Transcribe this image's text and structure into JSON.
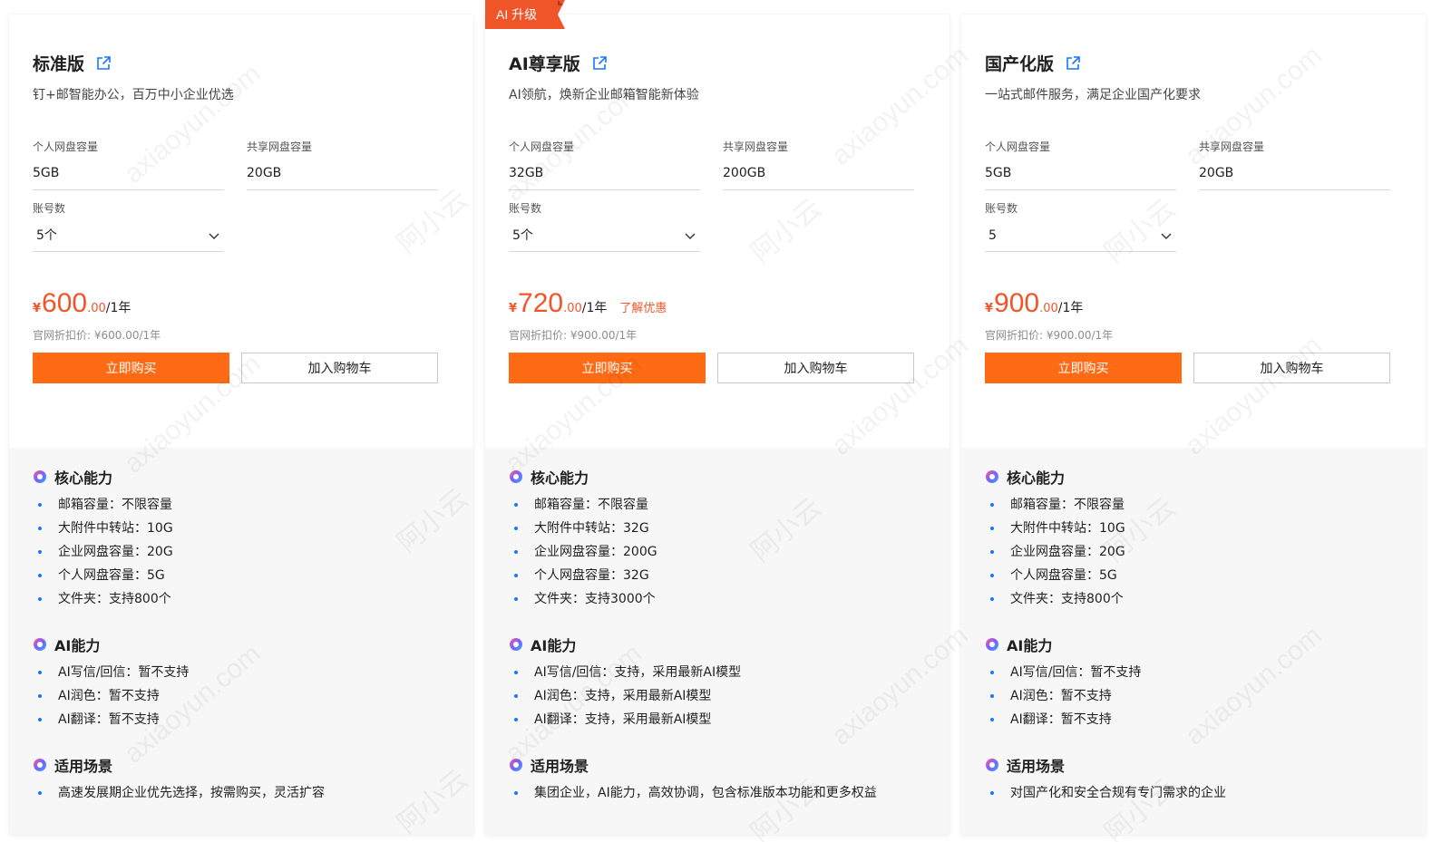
{
  "labels": {
    "personal_disk": "个人网盘容量",
    "shared_disk": "共享网盘容量",
    "accounts": "账号数",
    "buy": "立即购买",
    "add_cart": "加入购物车",
    "currency": "¥"
  },
  "watermark": {
    "site": "axiaoyun.com",
    "brand": "阿小云"
  },
  "colors": {
    "accent": "#ff6a14",
    "badge": "#f0552a",
    "bullet": "#1677ff",
    "bottom_bg": "#f7f7f7"
  },
  "plans": [
    {
      "badge": "",
      "title": "标准版",
      "subtitle": "钉+邮智能办公，百万中小企业优选",
      "personal_disk": "5GB",
      "shared_disk": "20GB",
      "accounts": "5个",
      "price_int": "600",
      "price_dec": ".00",
      "price_unit": "/1年",
      "promo": "",
      "orig_price": "官网折扣价: ¥600.00/1年",
      "sections": [
        {
          "title": "核心能力",
          "items": [
            "邮箱容量：不限容量",
            "大附件中转站：10G",
            "企业网盘容量：20G",
            "个人网盘容量：5G",
            "文件夹：支持800个"
          ]
        },
        {
          "title": "AI能力",
          "items": [
            "AI写信/回信：暂不支持",
            "AI润色：暂不支持",
            "AI翻译：暂不支持"
          ]
        },
        {
          "title": "适用场景",
          "items": [
            "高速发展期企业优先选择，按需购买，灵活扩容"
          ]
        }
      ]
    },
    {
      "badge": "AI 升级",
      "title": "AI尊享版",
      "subtitle": "AI领航，焕新企业邮箱智能新体验",
      "personal_disk": "32GB",
      "shared_disk": "200GB",
      "accounts": "5个",
      "price_int": "720",
      "price_dec": ".00",
      "price_unit": "/1年",
      "promo": "了解优惠",
      "orig_price": "官网折扣价: ¥900.00/1年",
      "sections": [
        {
          "title": "核心能力",
          "items": [
            "邮箱容量：不限容量",
            "大附件中转站：32G",
            "企业网盘容量：200G",
            "个人网盘容量：32G",
            "文件夹：支持3000个"
          ]
        },
        {
          "title": "AI能力",
          "items": [
            "AI写信/回信：支持，采用最新AI模型",
            "AI润色：支持，采用最新AI模型",
            "AI翻译：支持，采用最新AI模型"
          ]
        },
        {
          "title": "适用场景",
          "items": [
            "集团企业，AI能力，高效协调，包含标准版本功能和更多权益"
          ]
        }
      ]
    },
    {
      "badge": "",
      "title": "国产化版",
      "subtitle": "一站式邮件服务，满足企业国产化要求",
      "personal_disk": "5GB",
      "shared_disk": "20GB",
      "accounts": "5",
      "price_int": "900",
      "price_dec": ".00",
      "price_unit": "/1年",
      "promo": "",
      "orig_price": "官网折扣价: ¥900.00/1年",
      "sections": [
        {
          "title": "核心能力",
          "items": [
            "邮箱容量：不限容量",
            "大附件中转站：10G",
            "企业网盘容量：20G",
            "个人网盘容量：5G",
            "文件夹：支持800个"
          ]
        },
        {
          "title": "AI能力",
          "items": [
            "AI写信/回信：暂不支持",
            "AI润色：暂不支持",
            "AI翻译：暂不支持"
          ]
        },
        {
          "title": "适用场景",
          "items": [
            "对国产化和安全合规有专门需求的企业"
          ]
        }
      ]
    }
  ]
}
